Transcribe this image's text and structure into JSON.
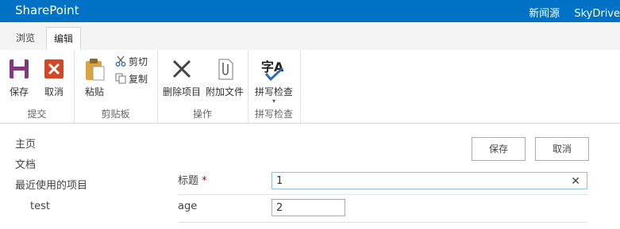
{
  "suitebar": {
    "brand": "SharePoint",
    "links": [
      "新闻源",
      "SkyDrive"
    ]
  },
  "tabs": [
    {
      "label": "浏览"
    },
    {
      "label": "编辑"
    }
  ],
  "ribbon": {
    "commit": {
      "group": "提交",
      "save": "保存",
      "cancel": "取消"
    },
    "clipboard": {
      "group": "剪贴板",
      "paste": "粘贴",
      "cut": "剪切",
      "copy": "复制"
    },
    "actions": {
      "group": "操作",
      "delete": "删除项目",
      "attach": "附加文件"
    },
    "spelling": {
      "group": "拼写检查",
      "spell": "拼写检查",
      "glyph": "字A"
    }
  },
  "nav": {
    "items": [
      "主页",
      "文档",
      "最近使用的项目",
      "test"
    ]
  },
  "form": {
    "save": "保存",
    "cancel": "取消",
    "title_label": "标题",
    "required_mark": "*",
    "title_value": "1",
    "age_label": "age",
    "age_value": "2"
  },
  "colors": {
    "suitebar": "#0072c6",
    "save_icon": "#80397b",
    "cancel_icon": "#d24726"
  }
}
